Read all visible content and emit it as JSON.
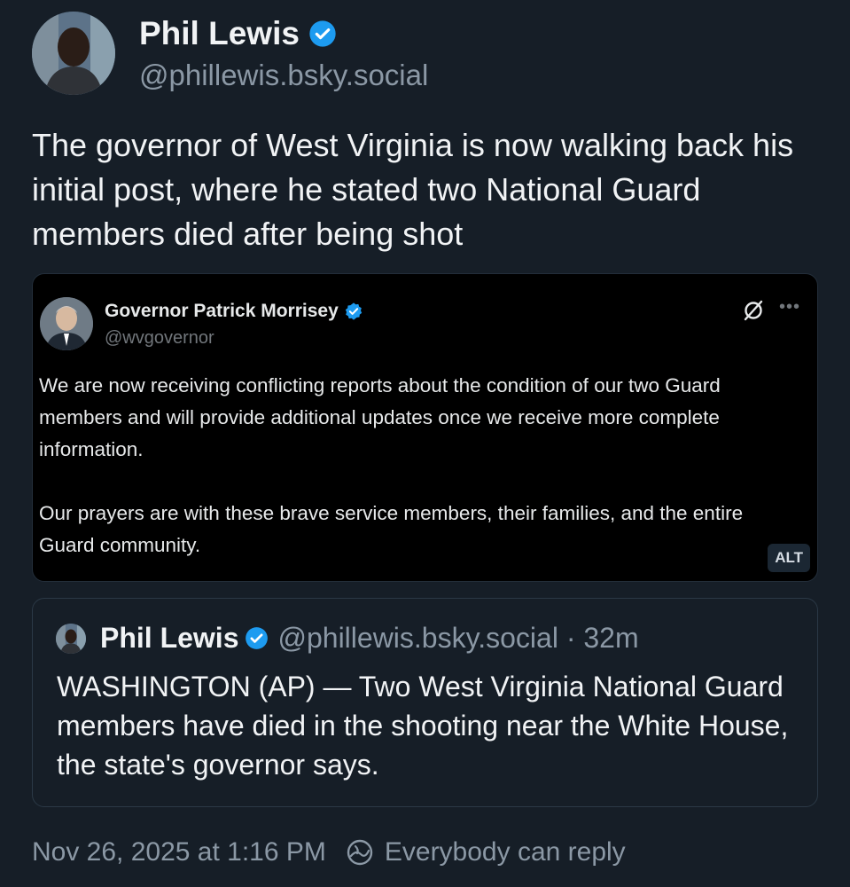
{
  "post": {
    "author_name": "Phil Lewis",
    "author_handle": "@phillewis.bsky.social",
    "text": "The governor of West Virginia is now walking back his initial post, where he stated two National Guard members died after being shot",
    "timestamp": "Nov 26, 2025 at 1:16 PM",
    "reply_setting": "Everybody can reply"
  },
  "embed": {
    "author_name": "Governor Patrick Morrisey",
    "author_handle": "@wvgovernor",
    "paragraph1": "We are now receiving conflicting reports about the condition of our two Guard members and will provide additional updates once we receive more complete information.",
    "paragraph2": "Our prayers are with these brave service members, their families, and the entire Guard community.",
    "alt_label": "ALT"
  },
  "quote": {
    "author_name": "Phil Lewis",
    "meta": "@phillewis.bsky.social · 32m",
    "text": "WASHINGTON (AP) — Two West Virginia National Guard members have died in the shooting near the White House, the state's governor says."
  },
  "icons": {
    "verified": "verified-check-icon",
    "grok": "grok-icon",
    "more": "more-options-icon",
    "reply": "reply-settings-icon"
  },
  "colors": {
    "background": "#161e27",
    "verified_blue": "#1d9bf0",
    "muted": "#8b98a5"
  }
}
